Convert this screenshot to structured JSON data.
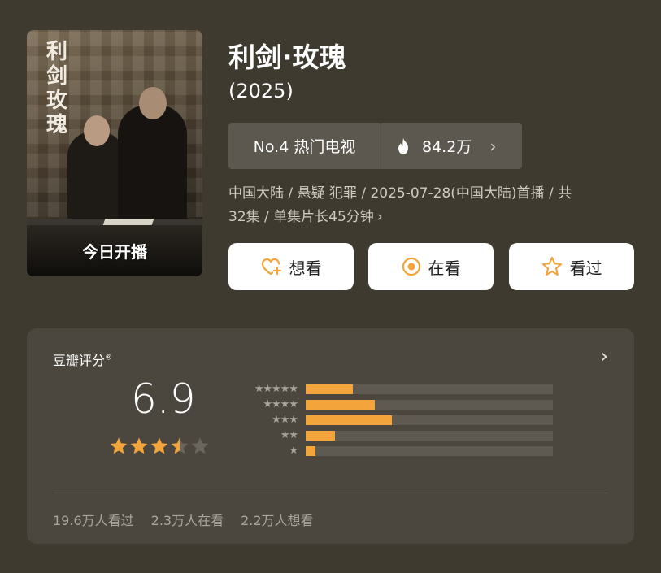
{
  "poster": {
    "title_vertical": "利剑玫瑰",
    "badge": "今日开播"
  },
  "show": {
    "title": "利剑·玫瑰",
    "year": "(2025)",
    "rank_label": "No.4 热门电视",
    "heat_value": "84.2万",
    "meta_line1": "中国大陆 / 悬疑 犯罪 / 2025-07-28(中国大陆)首播 / 共",
    "meta_line2": "32集 / 单集片长45分钟"
  },
  "actions": {
    "want_label": "想看",
    "watching_label": "在看",
    "watched_label": "看过"
  },
  "rating": {
    "label": "豆瓣评分",
    "mark": "®",
    "score": "6.9",
    "stars": 3.5,
    "distribution": [
      {
        "stars": 5,
        "fraction": 0.19
      },
      {
        "stars": 4,
        "fraction": 0.28
      },
      {
        "stars": 3,
        "fraction": 0.35
      },
      {
        "stars": 2,
        "fraction": 0.12
      },
      {
        "stars": 1,
        "fraction": 0.04
      }
    ],
    "watched": "19.6万人看过",
    "watching": "2.3万人在看",
    "want": "2.2万人想看"
  },
  "colors": {
    "accent": "#f3a43b",
    "background": "#3e3a30",
    "card": "#4b473e"
  }
}
